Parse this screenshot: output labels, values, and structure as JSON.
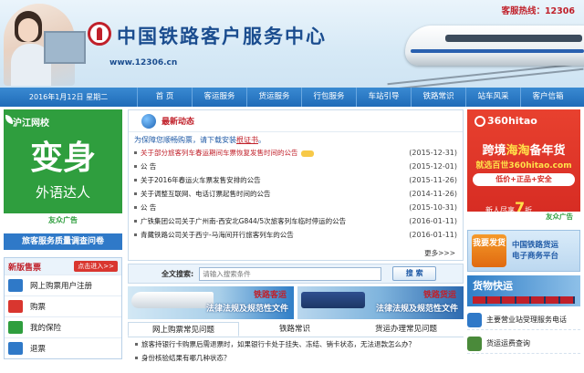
{
  "header": {
    "site_title": "中国铁路客户服务中心",
    "url": "www.12306.cn",
    "hotline": "客服热线：12306"
  },
  "nav": {
    "date": "2016年1月12日 星期二",
    "items": [
      "首  页",
      "客运服务",
      "货运服务",
      "行包服务",
      "车站引导",
      "铁路常识",
      "站车风采",
      "客户信箱"
    ]
  },
  "left": {
    "ad_hujiang": {
      "brand": "沪江网校",
      "big": "变身",
      "sub": "外语达人",
      "foot": "友众广告"
    },
    "survey": "旅客服务质量调查问卷",
    "ticket": {
      "title": "新版售票",
      "more": "点击进入>>",
      "items": [
        {
          "label": "网上购票用户注册",
          "color": "#2f79c8"
        },
        {
          "label": "购票",
          "color": "#d9362f"
        },
        {
          "label": "我的保险",
          "color": "#2f9e3e"
        },
        {
          "label": "退票",
          "color": "#2f79c8"
        }
      ]
    }
  },
  "news": {
    "title": "最新动态",
    "notice": "为保障您顺畅购票，请下载安装",
    "notice_link": "根证书",
    "notice_end": "。",
    "items": [
      {
        "text": "关于部分旅客列车春运期间车票恢复发售时间的公告",
        "date": "(2015-12-31)",
        "hot": true
      },
      {
        "text": "公 告",
        "date": "(2015-12-01)",
        "hot": false
      },
      {
        "text": "关于2016年春运火车票发售安排的公告",
        "date": "(2015-11-26)",
        "hot": false
      },
      {
        "text": "关于调整互联网、电话订票起售时间的公告",
        "date": "(2014-11-26)",
        "hot": false
      },
      {
        "text": "公 告",
        "date": "(2015-10-31)",
        "hot": false
      },
      {
        "text": "广铁集团公司关于广州南-西安北G844/5次旅客列车临时停运的公告",
        "date": "(2016-01-11)",
        "hot": false
      },
      {
        "text": "青藏铁路公司关于西宁-马海间开行旅客列车的公告",
        "date": "(2016-01-11)",
        "hot": false
      }
    ],
    "more": "更多>>>"
  },
  "search": {
    "label": "全文搜索:",
    "placeholder": "请输入搜索条件",
    "button": "搜 索"
  },
  "banners": [
    {
      "t1": "铁路客运",
      "t2": "法律法规及规范性文件"
    },
    {
      "t1": "铁路货运",
      "t2": "法律法规及规范性文件"
    }
  ],
  "tabs": [
    "网上购票常见问题",
    "铁路常识",
    "货运办理常见问题"
  ],
  "faq": [
    "旅客持银行卡购票后需退票时，如果银行卡处于挂失、冻结、销卡状态，无法退款怎么办？",
    "身份核验结果有哪几种状态？"
  ],
  "right": {
    "ad_360": {
      "logo": "360hitao",
      "h1a": "跨境",
      "h1b": "海淘",
      "h1c": "备年货",
      "h2": "就选百世360hitao.com",
      "h3": "低价+正品+安全",
      "h4a": "新人尽享",
      "h4b": "7",
      "h4c": "折",
      "foot": "友众广告"
    },
    "ecom_btn": "我要发货",
    "ecom_text_1": "中国铁路货运",
    "ecom_text_2": "电子商务平台",
    "cargo": "货物快运",
    "items": [
      "主要营业站受理服务电话",
      "货运运费查询"
    ]
  }
}
